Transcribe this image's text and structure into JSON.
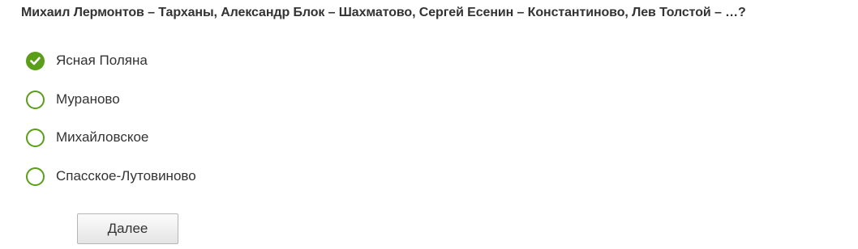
{
  "question": {
    "text": "Михаил Лермонтов – Тарханы, Александр Блок – Шахматово, Сергей Есенин – Константиново, Лев Толстой – …?"
  },
  "options": [
    {
      "label": "Ясная Поляна",
      "selected": true
    },
    {
      "label": "Мураново",
      "selected": false
    },
    {
      "label": "Михайловское",
      "selected": false
    },
    {
      "label": "Спасское-Лутовиново",
      "selected": false
    }
  ],
  "next_button": {
    "label": "Далее"
  },
  "colors": {
    "accent": "#5a9e1a",
    "text": "#333333"
  },
  "icons": {
    "selected": "check-icon"
  }
}
